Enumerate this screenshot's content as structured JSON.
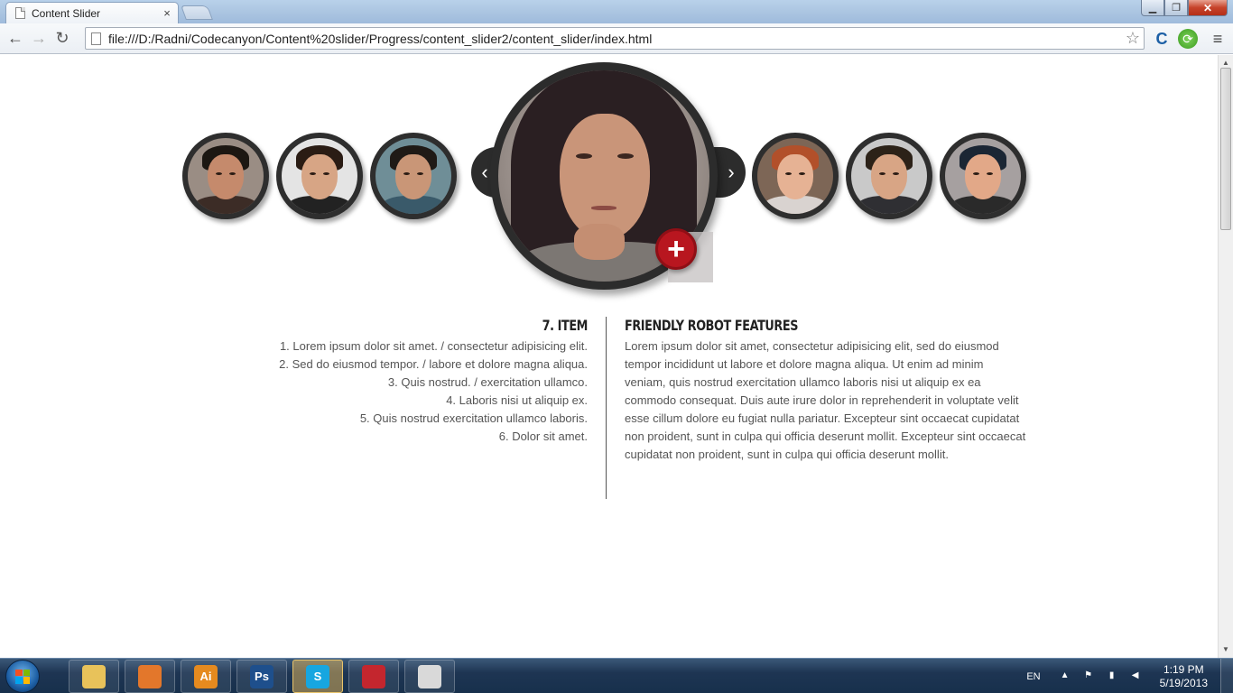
{
  "browser": {
    "tab_title": "Content Slider",
    "tab_close": "×",
    "url": "file:///D:/Radni/Codecanyon/Content%20slider/Progress/content_slider2/content_slider/index.html"
  },
  "slider": {
    "prev_label": "‹",
    "next_label": "›",
    "plus_label": "+",
    "left_thumbs": [
      {
        "skin": "#c58a6c",
        "hair": "#1c1712",
        "body": "#3c2c26",
        "bg": "#9a8d84"
      },
      {
        "skin": "#d7a585",
        "hair": "#2a1c14",
        "body": "#222222",
        "bg": "#e4e4e4"
      },
      {
        "skin": "#c99677",
        "hair": "#1f1a16",
        "body": "#3a5a6a",
        "bg": "#6f8e97"
      }
    ],
    "right_thumbs": [
      {
        "skin": "#e6b294",
        "hair": "#b2502a",
        "body": "#d9d3d0",
        "bg": "#7d6656"
      },
      {
        "skin": "#d8a585",
        "hair": "#2c2218",
        "body": "#2f2f33",
        "bg": "#c9c9c9"
      },
      {
        "skin": "#e2a888",
        "hair": "#1b2634",
        "body": "#2a2a2a",
        "bg": "#a6a0a0"
      }
    ]
  },
  "item": {
    "title": "7. Item",
    "lines": [
      "1. Lorem ipsum dolor sit amet. / consectetur adipisicing elit.",
      "2. Sed do eiusmod tempor. / labore et dolore magna aliqua.",
      "3. Quis nostrud. / exercitation ullamco.",
      "4. Laboris nisi ut aliquip ex.",
      "5. Quis nostrud exercitation ullamco laboris.",
      "6. Dolor sit amet."
    ]
  },
  "features": {
    "title": "Friendly Robot Features",
    "text": "Lorem ipsum dolor sit amet, consectetur adipisicing elit, sed do eiusmod tempor incididunt ut labore et dolore magna aliqua. Ut enim ad minim veniam, quis nostrud exercitation ullamco laboris nisi ut aliquip ex ea commodo consequat. Duis aute irure dolor in reprehenderit in voluptate velit esse cillum dolore eu fugiat nulla pariatur. Excepteur sint occaecat cupidatat non proident, sunt in culpa qui officia deserunt mollit. Excepteur sint occaecat cupidatat non proident, sunt in culpa qui officia deserunt mollit."
  },
  "taskbar": {
    "apps": [
      {
        "name": "explorer",
        "label": "",
        "color": "#e8c25a"
      },
      {
        "name": "firefox",
        "label": "",
        "color": "#e3772b"
      },
      {
        "name": "illustrator",
        "label": "Ai",
        "color": "#e58a1f"
      },
      {
        "name": "photoshop",
        "label": "Ps",
        "color": "#1e4f8c"
      },
      {
        "name": "skype",
        "label": "S",
        "color": "#17a6e0"
      },
      {
        "name": "app-red",
        "label": "",
        "color": "#c4262e"
      },
      {
        "name": "chrome",
        "label": "",
        "color": "#d9d9d9"
      }
    ],
    "lang": "EN",
    "time": "1:19 PM",
    "date": "5/19/2013"
  }
}
